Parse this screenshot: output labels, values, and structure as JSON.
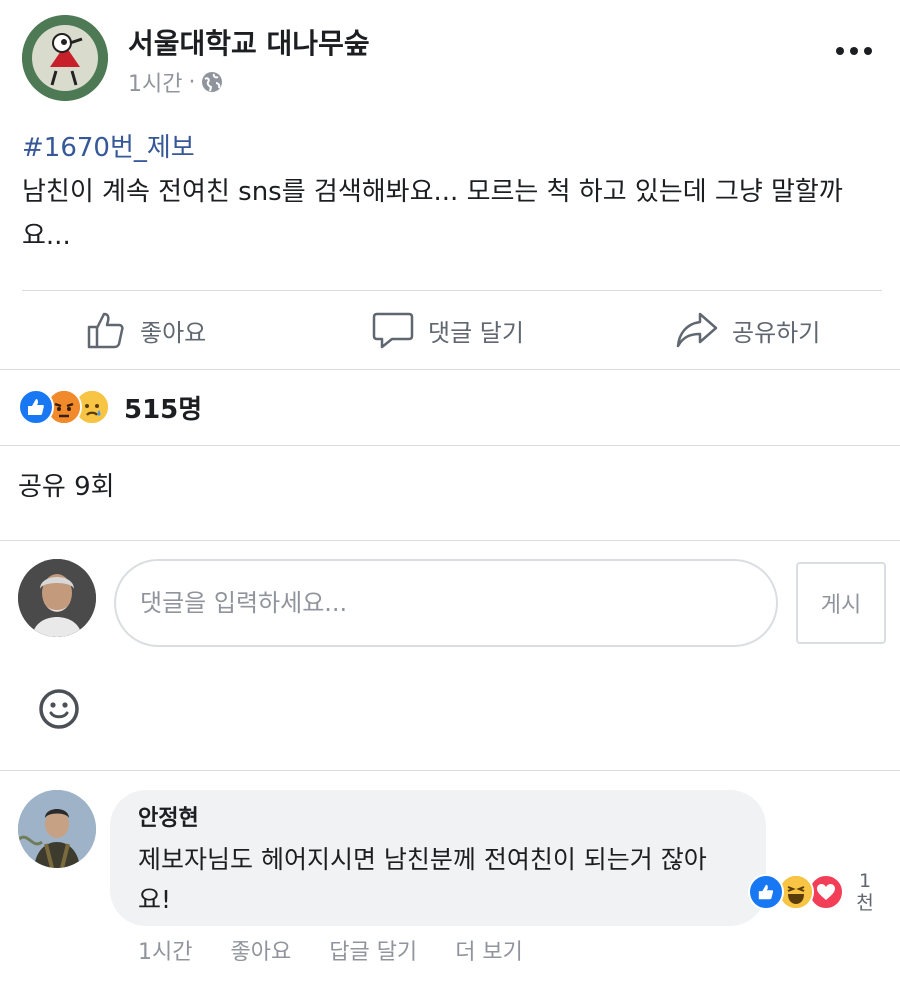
{
  "post": {
    "page_name": "서울대학교 대나무숲",
    "time": "1시간",
    "meta_separator": "·",
    "privacy_icon": "globe-icon",
    "hashtag": "#1670번_제보",
    "body": "남친이 계속 전여친 sns를 검색해봐요... 모르는 척 하고 있는데 그냥 말할까요..."
  },
  "actions": {
    "like_label": "좋아요",
    "comment_label": "댓글 달기",
    "share_label": "공유하기"
  },
  "reactions": {
    "icons": [
      "like-reaction-icon",
      "angry-reaction-icon",
      "sad-reaction-icon"
    ],
    "count": "515명"
  },
  "shares": {
    "label": "공유 9회"
  },
  "composer": {
    "placeholder": "댓글을 입력하세요...",
    "post_label": "게시"
  },
  "comment": {
    "author": "안정현",
    "text": "제보자님도 헤어지시면 남친분께 전여친이 되는거 잖아요!",
    "reaction_icons": [
      "like-reaction-icon",
      "haha-reaction-icon",
      "love-reaction-icon"
    ],
    "reaction_count": "1천",
    "time": "1시간",
    "like_label": "좋아요",
    "reply_label": "답글 달기",
    "more_label": "더 보기"
  },
  "colors": {
    "link": "#365899",
    "muted": "#90949c",
    "like_blue": "#1877f2",
    "love_red": "#f33e58",
    "emoji_yellow": "#f7b125",
    "angry_orange": "#e9710f"
  }
}
